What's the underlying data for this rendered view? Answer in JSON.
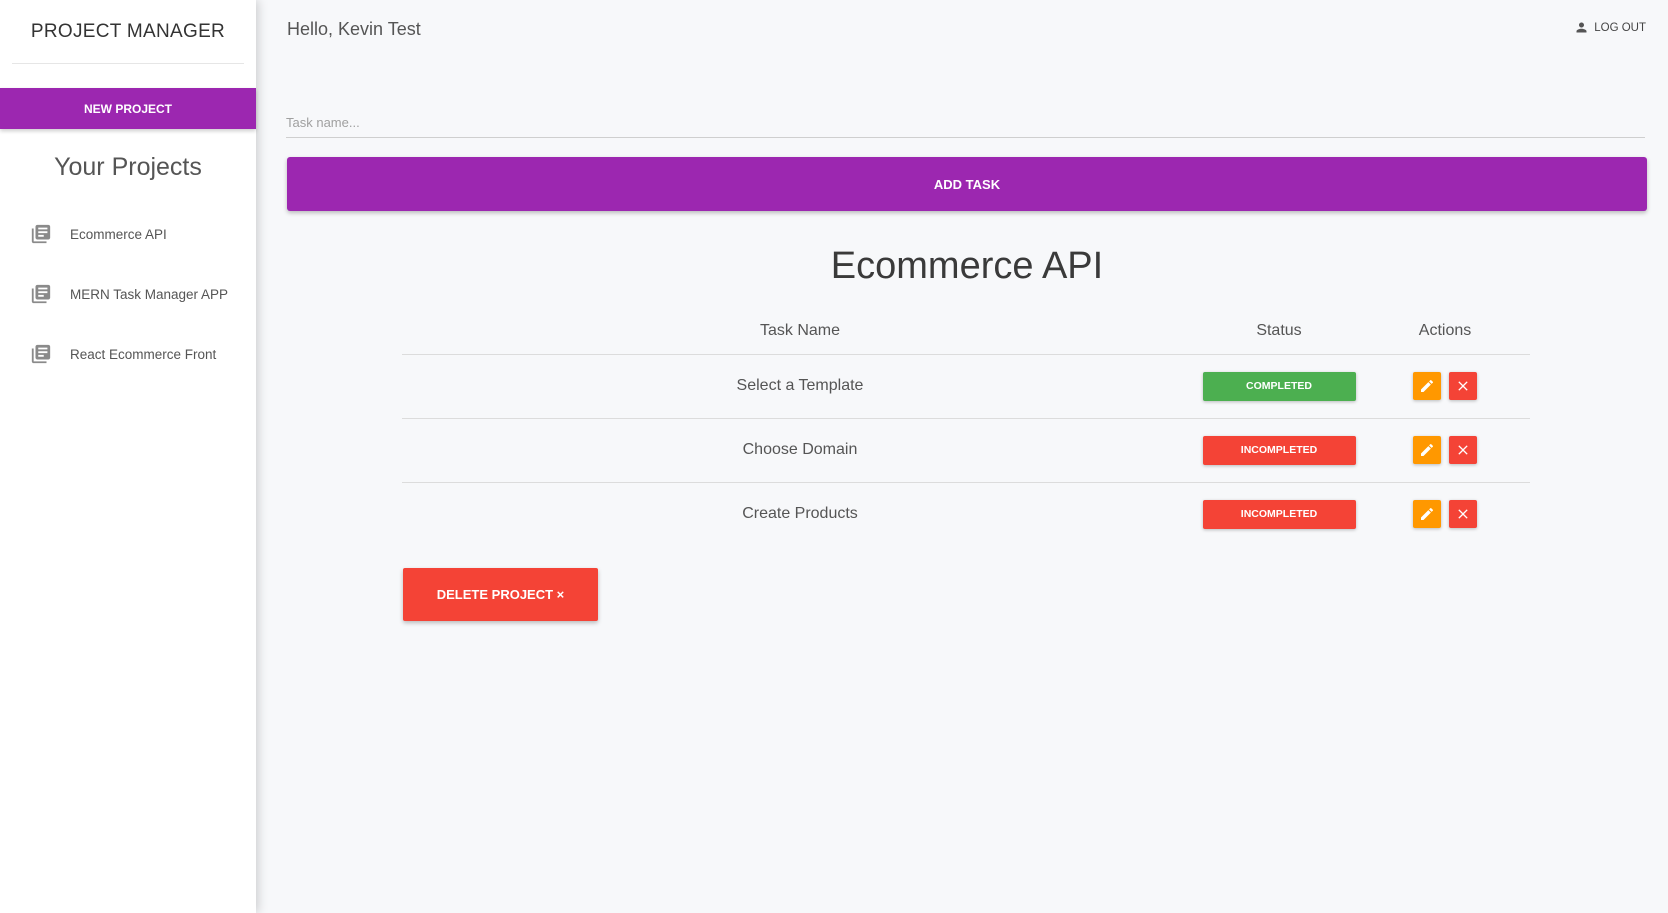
{
  "sidebar": {
    "brand": "PROJECT MANAGER",
    "new_project_label": "NEW PROJECT",
    "projects_heading": "Your Projects",
    "project_icon": "list-alt-icon",
    "projects": [
      {
        "label": "Ecommerce API"
      },
      {
        "label": "MERN Task Manager APP"
      },
      {
        "label": "React Ecommerce Front"
      }
    ]
  },
  "header": {
    "greeting": "Hello, Kevin Test",
    "logout_label": "LOG OUT",
    "logout_icon": "person-icon"
  },
  "task_form": {
    "placeholder": "Task name...",
    "value": "",
    "submit_label": "ADD TASK"
  },
  "project": {
    "title": "Ecommerce API",
    "columns": {
      "name": "Task Name",
      "status": "Status",
      "actions": "Actions"
    },
    "tasks": [
      {
        "name": "Select a Template",
        "status": "COMPLETED"
      },
      {
        "name": "Choose Domain",
        "status": "INCOMPLETED"
      },
      {
        "name": "Create Products",
        "status": "INCOMPLETED"
      }
    ],
    "delete_label": "DELETE PROJECT ×"
  },
  "colors": {
    "primary": "#9c27b0",
    "completed": "#4caf50",
    "incompleted": "#f44336",
    "edit": "#ff9800",
    "delete": "#f44336"
  }
}
